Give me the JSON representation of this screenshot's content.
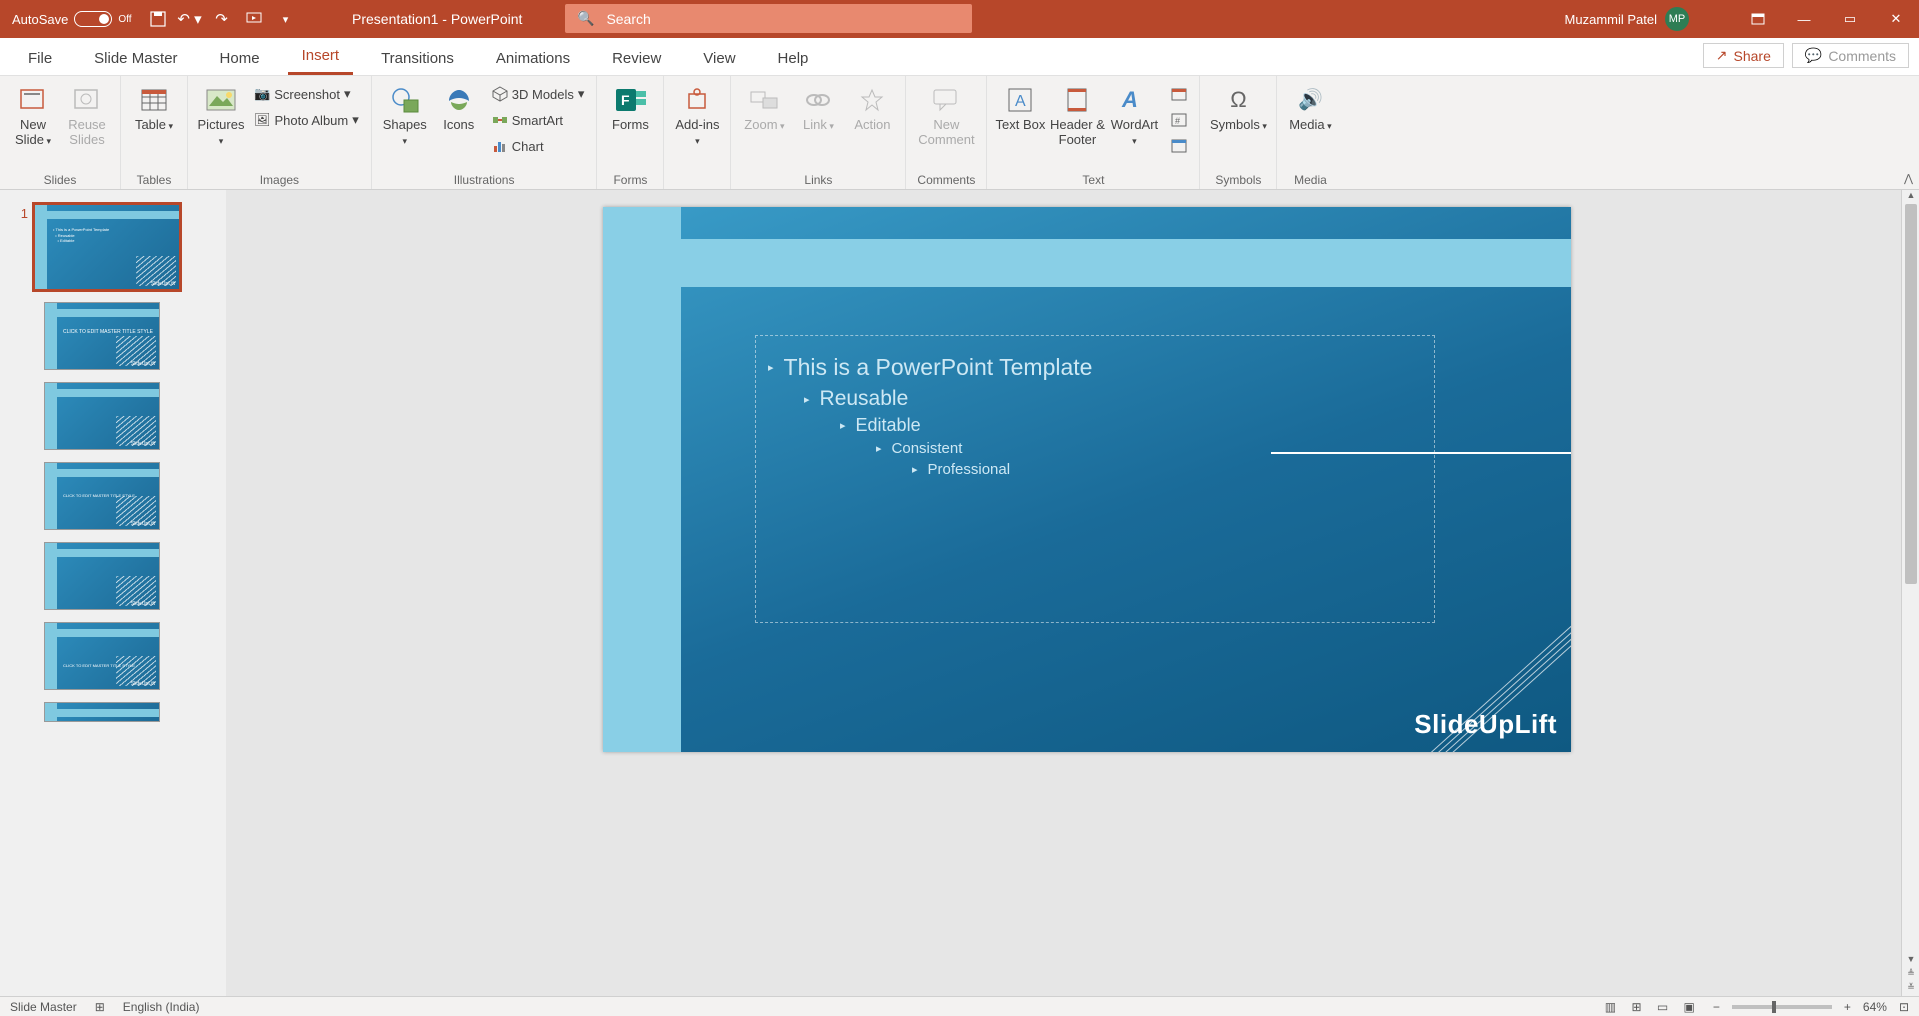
{
  "titlebar": {
    "autosave_label": "AutoSave",
    "autosave_state": "Off",
    "title": "Presentation1 - PowerPoint",
    "search_placeholder": "Search",
    "user_name": "Muzammil Patel",
    "user_initials": "MP"
  },
  "tabs": {
    "file": "File",
    "slide_master": "Slide Master",
    "home": "Home",
    "insert": "Insert",
    "transitions": "Transitions",
    "animations": "Animations",
    "review": "Review",
    "view": "View",
    "help": "Help",
    "share": "Share",
    "comments": "Comments"
  },
  "ribbon": {
    "slides": {
      "group": "Slides",
      "new_slide": "New Slide",
      "reuse_slides": "Reuse Slides"
    },
    "tables": {
      "group": "Tables",
      "table": "Table"
    },
    "images": {
      "group": "Images",
      "pictures": "Pictures",
      "screenshot": "Screenshot",
      "photo_album": "Photo Album"
    },
    "illustrations": {
      "group": "Illustrations",
      "shapes": "Shapes",
      "icons": "Icons",
      "models": "3D Models",
      "smartart": "SmartArt",
      "chart": "Chart"
    },
    "forms": {
      "group": "Forms",
      "forms": "Forms"
    },
    "addins": {
      "add_ins": "Add-ins"
    },
    "links": {
      "group": "Links",
      "zoom": "Zoom",
      "link": "Link",
      "action": "Action"
    },
    "comments": {
      "group": "Comments",
      "new_comment": "New Comment"
    },
    "text": {
      "group": "Text",
      "text_box": "Text Box",
      "header_footer": "Header & Footer",
      "wordart": "WordArt"
    },
    "symbols": {
      "group": "Symbols",
      "symbols": "Symbols"
    },
    "media": {
      "group": "Media",
      "media": "Media"
    }
  },
  "slide": {
    "bullets": {
      "l1": "This is a PowerPoint Template",
      "l2": "Reusable",
      "l3": "Editable",
      "l4": "Consistent",
      "l5": "Professional"
    },
    "logo": "SlideUpLift"
  },
  "thumbs": {
    "number_1": "1",
    "sub2_text": "CLICK TO EDIT MASTER TITLE STYLE",
    "sub4_text": "CLICK TO EDIT MASTER TITLE STYLE",
    "sub6_text": "CLICK TO EDIT MASTER TITLE STYLE"
  },
  "status": {
    "mode": "Slide Master",
    "language": "English (India)",
    "zoom": "64%"
  }
}
